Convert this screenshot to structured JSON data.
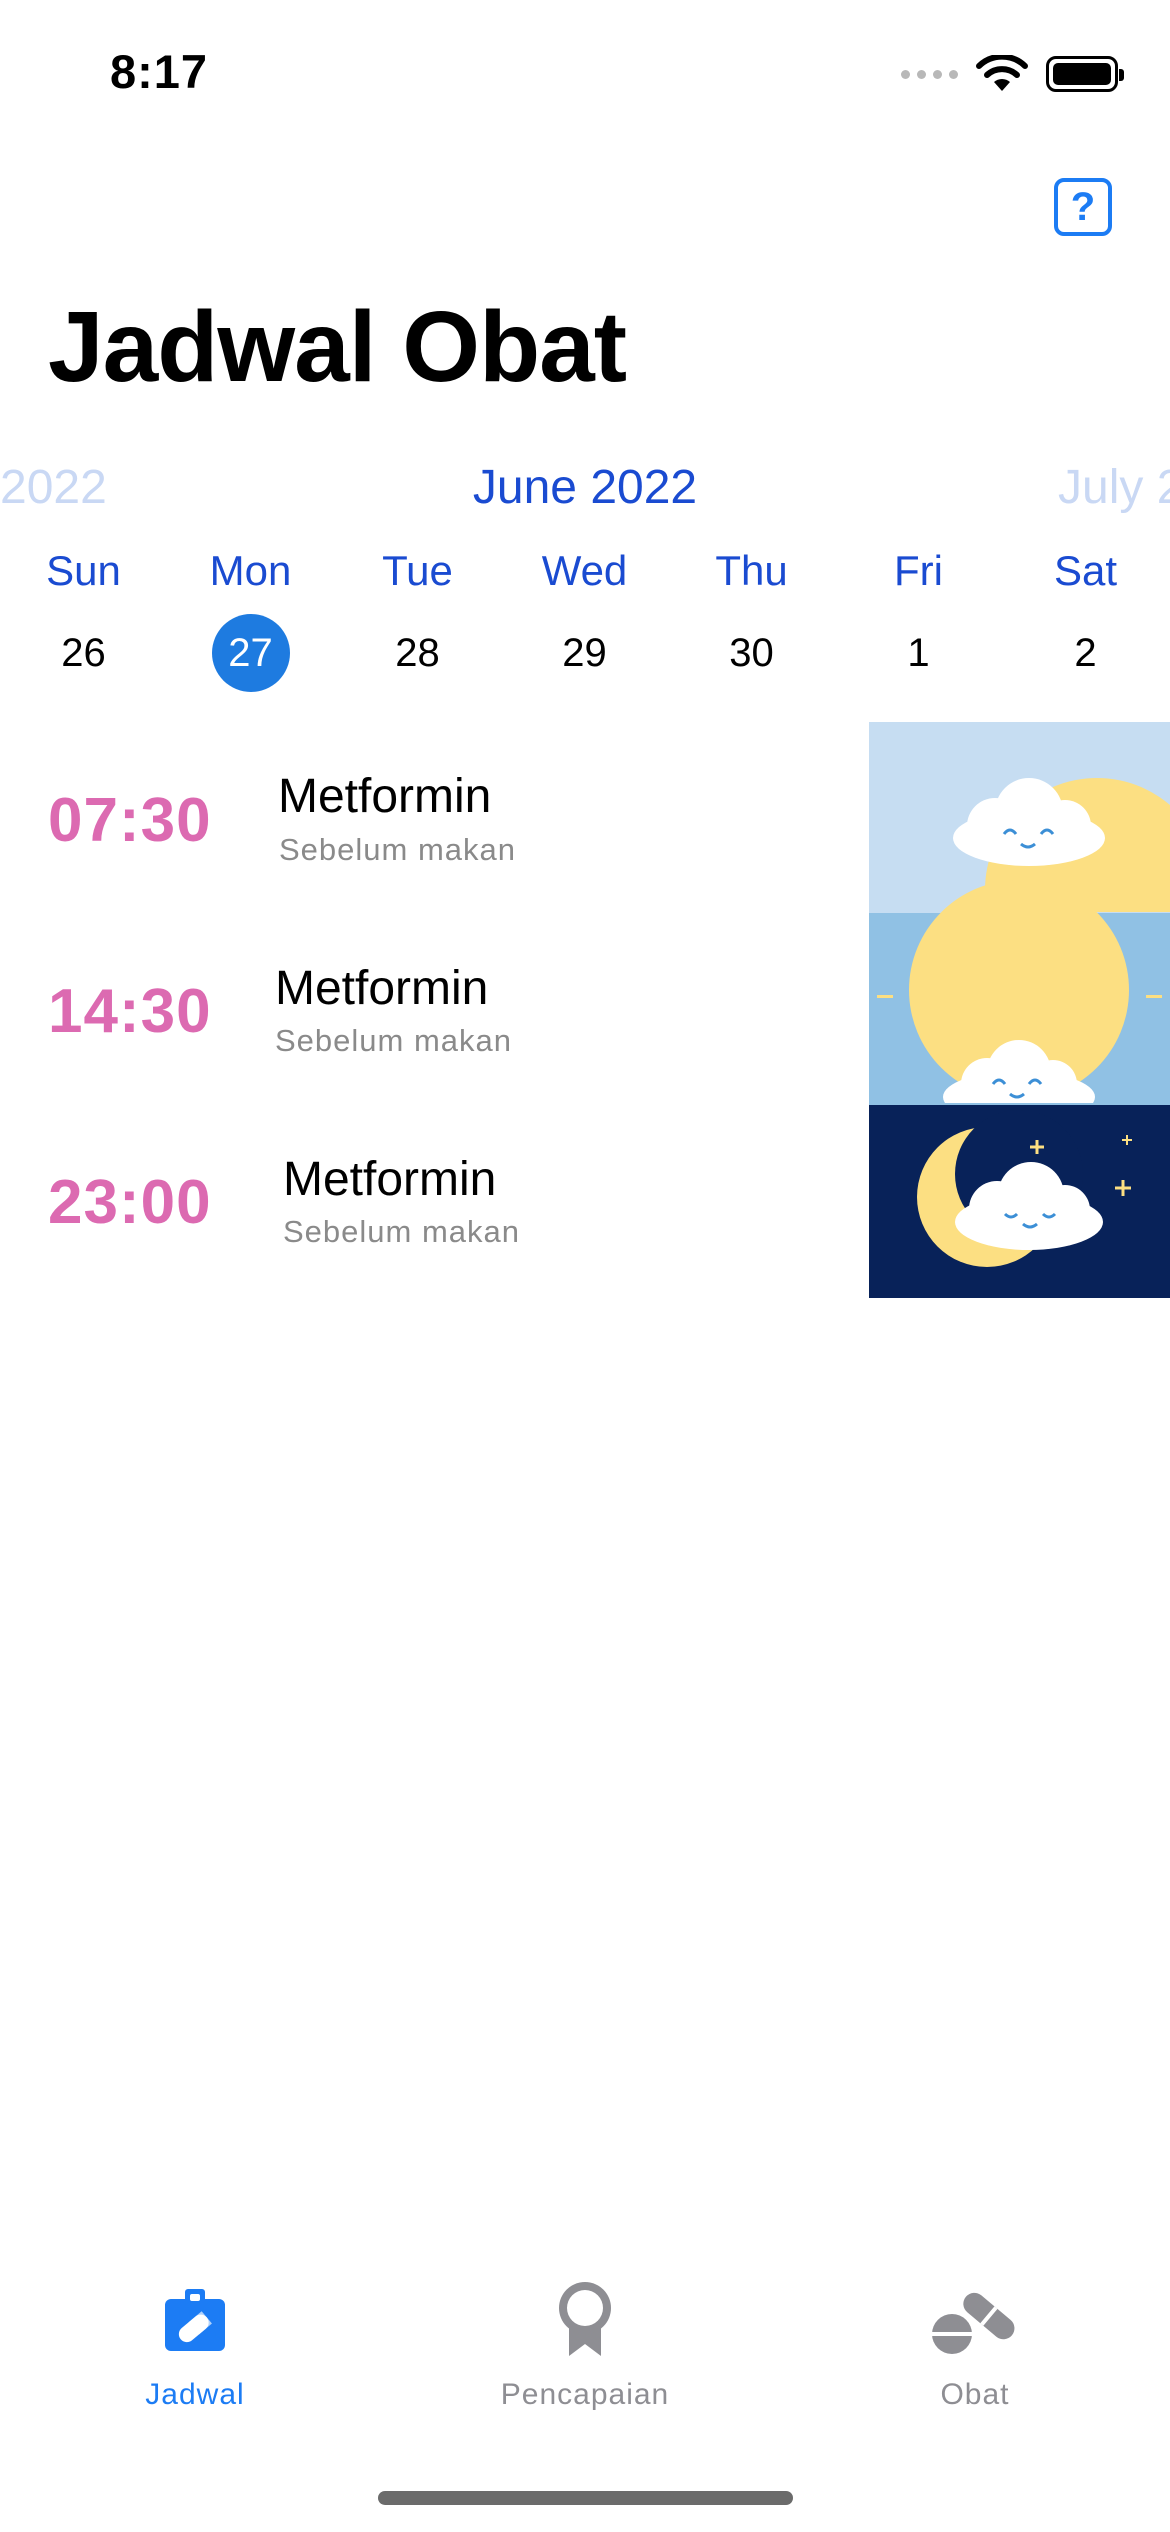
{
  "status_bar": {
    "time": "8:17",
    "signal_icon": "cellular-signal-icon",
    "wifi_icon": "wifi-icon",
    "battery_icon": "battery-icon"
  },
  "header": {
    "help_icon": "question-mark-icon",
    "help_label": "?",
    "title": "Jadwal Obat"
  },
  "calendar": {
    "prev_month": "2022",
    "current_month": "June 2022",
    "next_month": "July 2",
    "days": [
      {
        "name": "Sun",
        "date": "26"
      },
      {
        "name": "Mon",
        "date": "27"
      },
      {
        "name": "Tue",
        "date": "28"
      },
      {
        "name": "Wed",
        "date": "29"
      },
      {
        "name": "Thu",
        "date": "30"
      },
      {
        "name": "Fri",
        "date": "1"
      },
      {
        "name": "Sat",
        "date": "2"
      }
    ],
    "selected_date": "27"
  },
  "schedule": [
    {
      "time": "07:30",
      "medicine": "Metformin",
      "note": "Sebelum makan",
      "period": "morning"
    },
    {
      "time": "14:30",
      "medicine": "Metformin",
      "note": "Sebelum makan",
      "period": "afternoon"
    },
    {
      "time": "23:00",
      "medicine": "Metformin",
      "note": "Sebelum makan",
      "period": "night"
    }
  ],
  "tab_bar": {
    "tabs": [
      {
        "label": "Jadwal",
        "icon": "clipboard-pill-icon",
        "active": true
      },
      {
        "label": "Pencapaian",
        "icon": "ribbon-award-icon",
        "active": false
      },
      {
        "label": "Obat",
        "icon": "pills-icon",
        "active": false
      }
    ]
  },
  "colors": {
    "accent": "#1c7cf4",
    "calendar_blue": "#1a4bd1",
    "time_pink": "#dc6ab1",
    "selected_day": "#1e7be0",
    "inactive_tab": "#8e8e93",
    "morning_sky": "#c6ddf2",
    "afternoon_sky": "#90c1e4",
    "night_sky": "#082259",
    "sun_moon": "#fcdf82"
  }
}
